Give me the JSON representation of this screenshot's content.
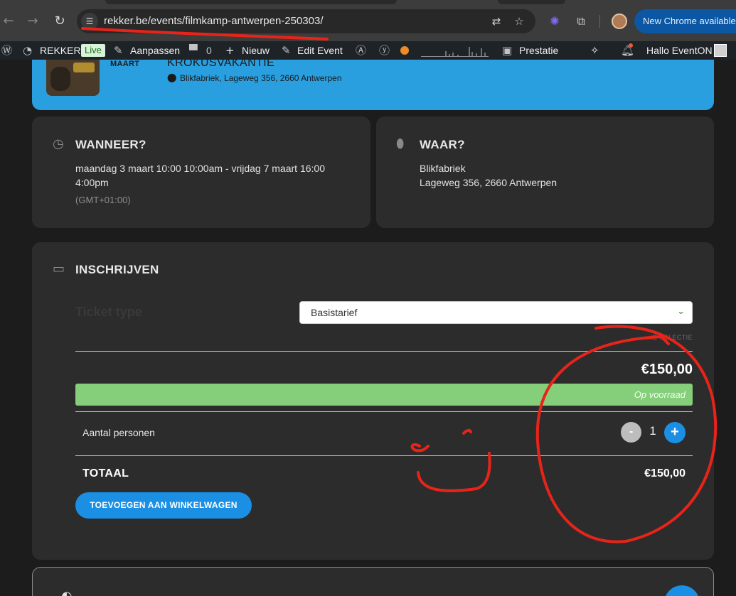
{
  "browser": {
    "url": "rekker.be/events/filmkamp-antwerpen-250303/",
    "new_chrome_label": "New Chrome available"
  },
  "icons": {
    "back": "arrow-left-icon",
    "forward": "arrow-right-icon",
    "reload": "reload-icon",
    "site_info": "tune-icon",
    "translate": "translate-icon",
    "bookmark": "star-icon",
    "extension_puzzle": "puzzle-icon",
    "clock": "clock-icon",
    "pin": "map-pin-icon",
    "ticket": "ticket-icon"
  },
  "wp_admin": {
    "site_name": "REKKER",
    "live_badge": "Live",
    "customize": "Aanpassen",
    "comments_count": "0",
    "new": "Nieuw",
    "edit_event": "Edit Event",
    "performance": "Prestatie",
    "greeting": "Hallo EventON"
  },
  "event": {
    "month": "MAART",
    "title": "KROKUSVAKANTIE",
    "location": "Blikfabriek, Lageweg 356, 2660 Antwerpen"
  },
  "when": {
    "heading": "WANNEER?",
    "line1": "maandag 3 maart 10:00 10:00am - vrijdag 7 maart 16:00",
    "line2": "4:00pm",
    "timezone": "(GMT+01:00)"
  },
  "where": {
    "heading": "WAAR?",
    "venue": "Blikfabriek",
    "address": "Lageweg 356, 2660 Antwerpen"
  },
  "registration": {
    "heading": "INSCHRIJVEN",
    "ticket_type_label": "Ticket type",
    "ticket_type_value": "Basistarief",
    "selection_hint": "…IE SELECTIE",
    "price": "€150,00",
    "stock_status": "Op voorraad",
    "quantity_label": "Aantal personen",
    "minus": "-",
    "quantity": "1",
    "plus": "+",
    "total_label": "TOTAAL",
    "total_value": "€150,00",
    "add_to_cart": "TOEVOEGEN AAN WINKELWAGEN"
  },
  "colors": {
    "hero": "#2a9fe0",
    "accent": "#1a8fe3",
    "stock": "#85cf7a",
    "annotation": "#e8241a"
  }
}
